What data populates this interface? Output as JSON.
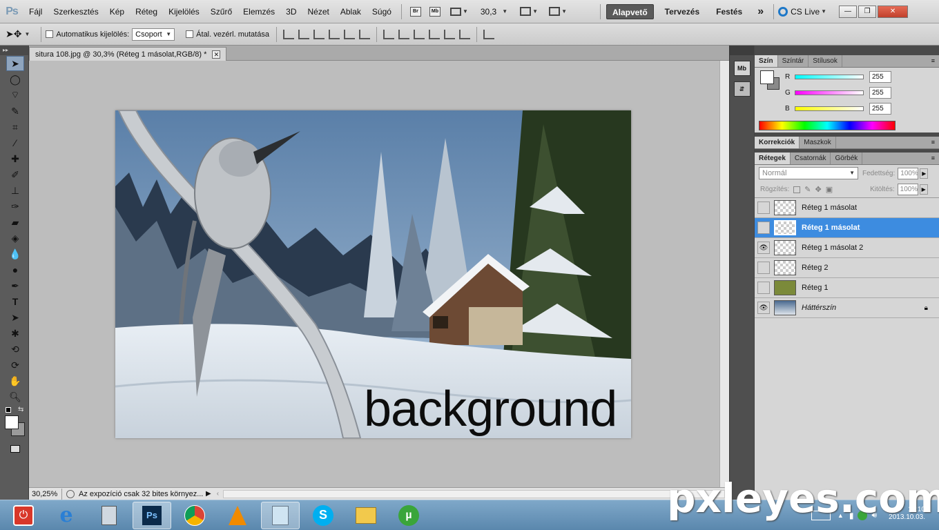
{
  "app": {
    "logo": "Ps"
  },
  "menu": [
    "Fájl",
    "Szerkesztés",
    "Kép",
    "Réteg",
    "Kijelölés",
    "Szűrő",
    "Elemzés",
    "3D",
    "Nézet",
    "Ablak",
    "Súgó"
  ],
  "appbar": {
    "br": "Br",
    "mb": "Mb",
    "zoom": "30,3"
  },
  "workspaces": {
    "active": "Alapvető",
    "items": [
      "Tervezés",
      "Festés"
    ],
    "more": "»",
    "cslive": "CS Live"
  },
  "options": {
    "auto_select_label": "Automatikus kijelölés:",
    "auto_select_value": "Csoport",
    "transform_label": "Átal. vezérl. mutatása"
  },
  "document": {
    "tab_title": "situra 108.jpg @ 30,3% (Réteg 1 másolat,RGB/8) *",
    "close": "✕"
  },
  "canvas_text": "background",
  "status": {
    "zoom": "30,25%",
    "info": "Az expozíció csak 32 bites környez..."
  },
  "color_panel": {
    "tabs": [
      "Szín",
      "Színtár",
      "Stílusok"
    ],
    "channels": [
      {
        "label": "R",
        "value": "255",
        "color": "#00e0e0"
      },
      {
        "label": "G",
        "value": "255",
        "color": "#e020e0"
      },
      {
        "label": "B",
        "value": "255",
        "color": "#e8e800"
      }
    ]
  },
  "adjust_panel": {
    "tabs": [
      "Korrekciók",
      "Maszkok"
    ]
  },
  "layers_panel": {
    "tabs": [
      "Rétegek",
      "Csatornák",
      "Görbék"
    ],
    "blend_mode": "Normál",
    "opacity_label": "Fedettség:",
    "opacity": "100%",
    "lock_label": "Rögzítés:",
    "fill_label": "Kitöltés:",
    "fill": "100%",
    "layers": [
      {
        "name": "Réteg 1 másolat",
        "visible": false,
        "selected": false
      },
      {
        "name": "Réteg 1 másolat",
        "visible": false,
        "selected": true
      },
      {
        "name": "Réteg 1 másolat 2",
        "visible": true,
        "selected": false
      },
      {
        "name": "Réteg 2",
        "visible": false,
        "selected": false
      },
      {
        "name": "Réteg 1",
        "visible": false,
        "selected": false
      },
      {
        "name": "Háttérszín",
        "visible": true,
        "selected": false,
        "locked": true
      }
    ]
  },
  "taskbar": {
    "clock_time": "18:10",
    "clock_date": "2013.10.03."
  },
  "watermark": "pxleyes.com"
}
